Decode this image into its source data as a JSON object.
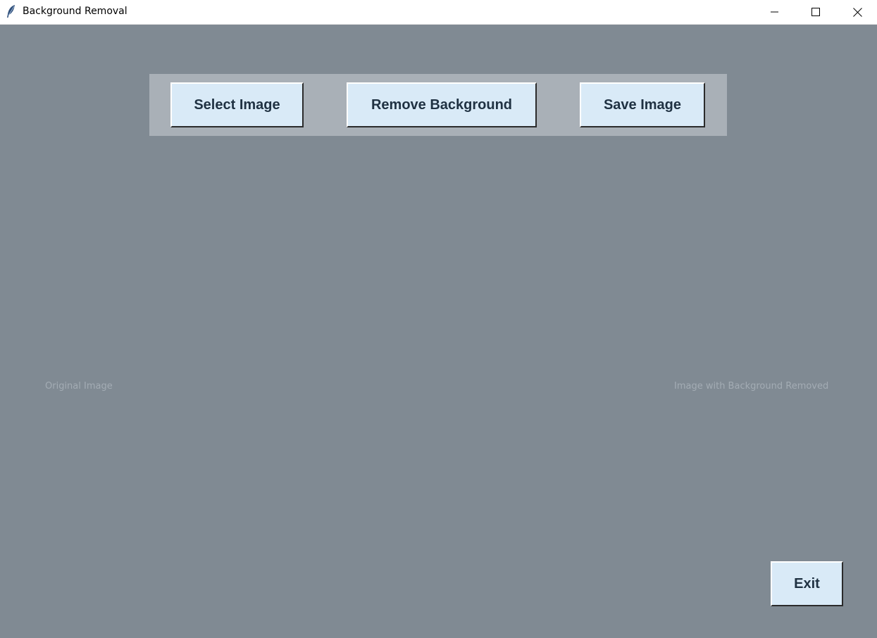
{
  "window": {
    "title": "Background Removal",
    "controls": {
      "minimize_icon": "minimize-icon",
      "maximize_icon": "maximize-icon",
      "close_icon": "close-icon"
    }
  },
  "toolbar": {
    "select_label": "Select Image",
    "remove_label": "Remove Background",
    "save_label": "Save Image"
  },
  "panels": {
    "original_caption": "Original Image",
    "removed_caption": "Image with Background Removed"
  },
  "footer": {
    "exit_label": "Exit"
  },
  "colors": {
    "background": "#808a93",
    "toolbar_panel": "#a9b0b7",
    "button_face": "#d9eaf7",
    "button_text": "#1f3142",
    "caption_text": "#a3acb4"
  }
}
